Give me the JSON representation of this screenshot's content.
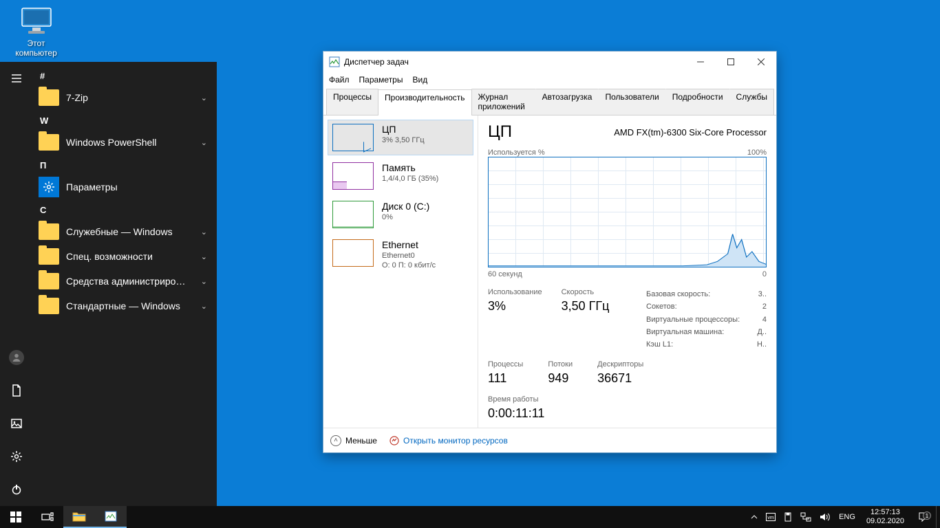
{
  "desktop": {
    "this_pc": "Этот компьютер"
  },
  "start_menu": {
    "letters": {
      "hash": "#",
      "w": "W",
      "p": "П",
      "s": "С"
    },
    "items": {
      "sevenzip": "7-Zip",
      "powershell": "Windows PowerShell",
      "settings": "Параметры",
      "services": "Служебные — Windows",
      "accessibility": "Спец. возможности",
      "admintools": "Средства администрирования...",
      "accessories": "Стандартные — Windows"
    }
  },
  "tm": {
    "title": "Диспетчер задач",
    "menu": {
      "file": "Файл",
      "options": "Параметры",
      "view": "Вид"
    },
    "tabs": {
      "processes": "Процессы",
      "performance": "Производительность",
      "apphistory": "Журнал приложений",
      "startup": "Автозагрузка",
      "users": "Пользователи",
      "details": "Подробности",
      "services": "Службы"
    },
    "side": {
      "cpu": {
        "title": "ЦП",
        "sub": "3%  3,50 ГГц"
      },
      "mem": {
        "title": "Память",
        "sub": "1,4/4,0 ГБ (35%)"
      },
      "disk": {
        "title": "Диск 0 (C:)",
        "sub": "0%"
      },
      "eth": {
        "title": "Ethernet",
        "sub1": "Ethernet0",
        "sub2": "О: 0  П: 0 кбит/с"
      }
    },
    "main": {
      "heading": "ЦП",
      "subtitle": "AMD FX(tm)-6300 Six-Core Processor",
      "used_lbl": "Используется %",
      "pct100": "100%",
      "sixty": "60 секунд",
      "zero": "0",
      "usage_lbl": "Использование",
      "usage_val": "3%",
      "speed_lbl": "Скорость",
      "speed_val": "3,50 ГГц",
      "proc_lbl": "Процессы",
      "proc_val": "111",
      "threads_lbl": "Потоки",
      "threads_val": "949",
      "handles_lbl": "Дескрипторы",
      "handles_val": "36671",
      "base_lbl": "Базовая скорость:",
      "base_val": "3..",
      "sockets_lbl": "Сокетов:",
      "sockets_val": "2",
      "vproc_lbl": "Виртуальные процессоры:",
      "vproc_val": "4",
      "vm_lbl": "Виртуальная машина:",
      "vm_val": "Д..",
      "l1_lbl": "Кэш L1:",
      "l1_val": "Н..",
      "uptime_lbl": "Время работы",
      "uptime_val": "0:00:11:11"
    },
    "footer": {
      "less": "Меньше",
      "resmon": "Открыть монитор ресурсов"
    }
  },
  "taskbar": {
    "lang": "ENG",
    "time": "12:57:13",
    "date": "09.02.2020",
    "notif_count": "1"
  },
  "chart_data": {
    "type": "line",
    "title": "ЦП Используется %",
    "xlabel": "60 секунд → 0",
    "ylabel": "Используется %",
    "ylim": [
      0,
      100
    ],
    "x_seconds_ago": [
      60,
      55,
      50,
      45,
      40,
      35,
      30,
      25,
      20,
      15,
      12,
      10,
      8,
      6,
      5,
      4,
      3,
      2,
      1,
      0
    ],
    "values": [
      1,
      1,
      1,
      1,
      1,
      1,
      1,
      1,
      1,
      2,
      3,
      5,
      12,
      30,
      18,
      26,
      10,
      14,
      6,
      3
    ]
  }
}
